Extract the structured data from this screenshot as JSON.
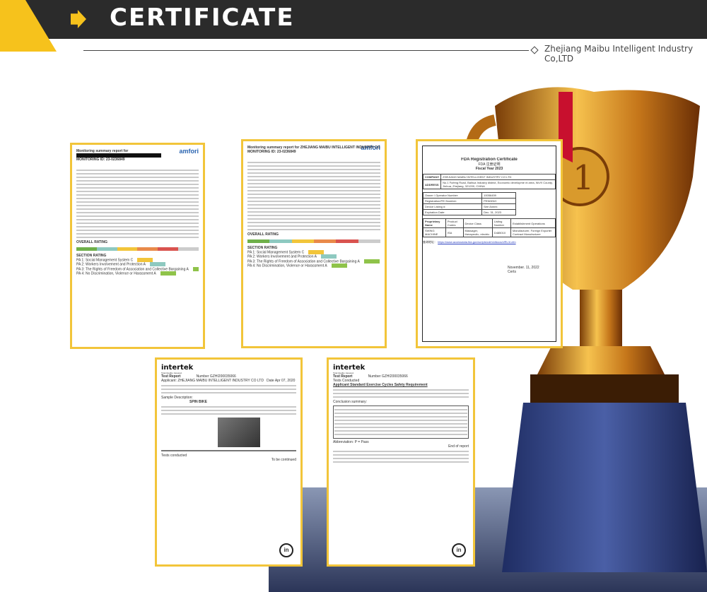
{
  "header": {
    "title": "CERTIFICATE",
    "company": "Zhejiang Maibu Intelligent Industry Co,LTD"
  },
  "docs": {
    "amfori1": {
      "line1": "Monitoring summary report for",
      "line2": "MONITORING ID: 23-0236849",
      "logo": "amfori",
      "overall": "OVERALL RATING",
      "section": "SECTION RATING",
      "pa1": "PA 1: Social Management System",
      "pa2": "PA 2: Workers Involvement and Protection",
      "pa3": "PA 3: The Rights of Freedom of Association and Collective Bargaining",
      "pa4": "PA 4: No Discrimination, Violence or Harassment",
      "grades": [
        "C",
        "A",
        "A",
        "A"
      ]
    },
    "amfori2": {
      "line1": "Monitoring summary report for ZHEJIANG MAIBU INTELLIGENT INDUSTRY CO.LTD",
      "line2": "MONITORING ID: 23-0236849",
      "logo": "amfori",
      "overall": "OVERALL RATING",
      "section": "SECTION RATING",
      "pa1": "PA 1: Social Management System",
      "pa2": "PA 2: Workers Involvement and Protection",
      "pa3": "PA 3: The Rights of Freedom of Association and Collective Bargaining",
      "pa4": "PA 4: No Discrimination, Violence or Harassment",
      "grades": [
        "C",
        "A",
        "A",
        "A"
      ]
    },
    "fda": {
      "title": "FDA Registration Certificate",
      "subtitle": "FDA 注册证明",
      "year": "Fiscal Year 2023",
      "company_label": "COMPANY",
      "company": "ZHEJIANG MAIBU INTELLIGENT INDUSTRY CO LTD",
      "address_label": "ADDRESS",
      "address": "No.1 Fufeng Road, Baihua Industry district, Economic developme nt area, WuYi County, Jinhua, Zhejiang, 321200, CHINA",
      "owner_label": "Owner / Operator Number:",
      "owner": "10056459",
      "reg_label": "Registration/FEI Number:",
      "reg": "PENDING",
      "listing_label": "Device Listing #:",
      "listing": "See Annex",
      "exp_label": "Expiration Date:",
      "exp": "Dec. 31, 2023",
      "col1": "Proprietary Name",
      "col2": "Product Codes",
      "col3": "Device Class",
      "col4": "Listing Number",
      "col5": "Establishment Operations",
      "row_name": "SWING MACHINE",
      "row_code": "ISA",
      "row_class": "Massager, therapeutic, electric",
      "row_listing": "D485010",
      "row_ops": "Manufacturer, Foreign Exporter Contract Manufacturer",
      "link_label": "查询地址：",
      "link": "https://www.accessdata.fda.gov/scripts/cdrh/cfdocs/cfRL/rl.cfm",
      "date": "November. 11, 2022",
      "sign": "Certs"
    },
    "intertek1": {
      "logo": "intertek",
      "tagline": "Total Quality. Assured.",
      "report": "Test Report",
      "number_label": "Number",
      "number": "GZHI200035066",
      "applicant_label": "Applicant",
      "applicant": "ZHEJIANG MAIBU INTELLIGENT INDUSTRY CO LTD",
      "date_label": "Date",
      "date": "Apr 07, 2020",
      "sample": "Sample Description:",
      "item": "SPIN BIKE",
      "conducted": "Tests conducted",
      "continued": "To be continued"
    },
    "intertek2": {
      "logo": "intertek",
      "tagline": "Total Quality. Assured.",
      "report": "Test Report",
      "number_label": "Number",
      "number": "GZHI200035066",
      "conducted": "Tests Conducted",
      "requirement": "Applicant Standard Exercise Cycles Safety Requirement",
      "summary": "Conclusion summary:",
      "abbr": "Abbreviation: P = Pass",
      "end": "End of report"
    }
  }
}
